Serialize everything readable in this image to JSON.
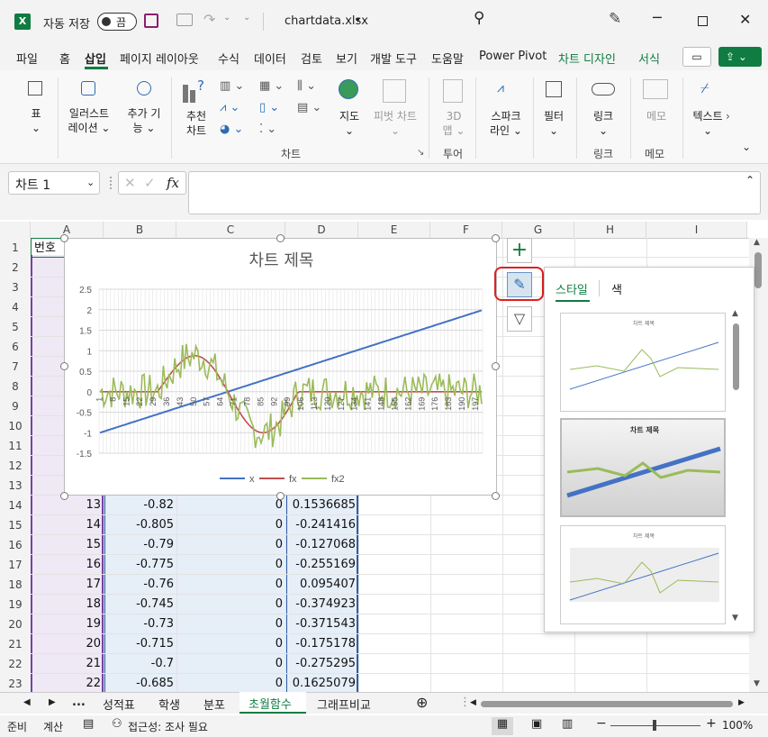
{
  "titlebar": {
    "autosave_label": "자동 저장",
    "autosave_state": "끔",
    "filename": "chartdata.xlsx"
  },
  "tabs": [
    "파일",
    "홈",
    "삽입",
    "페이지 레이아웃",
    "수식",
    "데이터",
    "검토",
    "보기",
    "개발 도구",
    "도움말",
    "Power Pivot",
    "차트 디자인",
    "서식"
  ],
  "active_tab": "삽입",
  "ribbon": {
    "buttons": [
      {
        "name": "table",
        "lines": [
          "표",
          "⌄"
        ]
      },
      {
        "name": "illustrations",
        "lines": [
          "일러스트",
          "레이션 ⌄"
        ]
      },
      {
        "name": "addins",
        "lines": [
          "추가 기",
          "능 ⌄"
        ]
      },
      {
        "name": "recommended-charts",
        "lines": [
          "추천",
          "차트"
        ]
      },
      {
        "name": "maps",
        "lines": [
          "지도",
          "⌄"
        ]
      },
      {
        "name": "pivotchart",
        "lines": [
          "피벗 차트",
          "⌄"
        ]
      },
      {
        "name": "3dmap",
        "lines": [
          "3D",
          "맵 ⌄"
        ]
      },
      {
        "name": "sparklines",
        "lines": [
          "스파크",
          "라인 ⌄"
        ]
      },
      {
        "name": "filters",
        "lines": [
          "필터",
          "⌄"
        ]
      },
      {
        "name": "link",
        "lines": [
          "링크",
          "⌄"
        ]
      },
      {
        "name": "comment",
        "lines": [
          "메모",
          ""
        ]
      },
      {
        "name": "text",
        "lines": [
          "텍스트",
          "⌄"
        ]
      }
    ],
    "groups": [
      "차트",
      "투어",
      "링크",
      "메모"
    ]
  },
  "formula": {
    "namebox": "차트 1",
    "fx": "fx"
  },
  "columns": [
    "A",
    "B",
    "C",
    "D",
    "E",
    "F",
    "G",
    "H",
    "I"
  ],
  "rows": [
    {
      "n": "1",
      "a": "번호",
      "b": "",
      "c": "",
      "d": ""
    },
    {
      "n": "2",
      "a": "",
      "b": "",
      "c": "",
      "d": ""
    },
    {
      "n": "3",
      "a": "",
      "b": "",
      "c": "",
      "d": ""
    },
    {
      "n": "4",
      "a": "",
      "b": "",
      "c": "",
      "d": ""
    },
    {
      "n": "5",
      "a": "",
      "b": "",
      "c": "",
      "d": ""
    },
    {
      "n": "6",
      "a": "",
      "b": "",
      "c": "",
      "d": ""
    },
    {
      "n": "7",
      "a": "",
      "b": "",
      "c": "",
      "d": ""
    },
    {
      "n": "8",
      "a": "",
      "b": "",
      "c": "",
      "d": ""
    },
    {
      "n": "9",
      "a": "",
      "b": "",
      "c": "",
      "d": ""
    },
    {
      "n": "10",
      "a": "",
      "b": "",
      "c": "",
      "d": ""
    },
    {
      "n": "11",
      "a": "",
      "b": "",
      "c": "",
      "d": ""
    },
    {
      "n": "12",
      "a": "",
      "b": "",
      "c": "",
      "d": ""
    },
    {
      "n": "13",
      "a": "",
      "b": "",
      "c": "",
      "d": ""
    },
    {
      "n": "14",
      "a": "13",
      "b": "-0.82",
      "c": "0",
      "d": "0.1536685"
    },
    {
      "n": "15",
      "a": "14",
      "b": "-0.805",
      "c": "0",
      "d": "-0.241416"
    },
    {
      "n": "16",
      "a": "15",
      "b": "-0.79",
      "c": "0",
      "d": "-0.127068"
    },
    {
      "n": "17",
      "a": "16",
      "b": "-0.775",
      "c": "0",
      "d": "-0.255169"
    },
    {
      "n": "18",
      "a": "17",
      "b": "-0.76",
      "c": "0",
      "d": "0.095407"
    },
    {
      "n": "19",
      "a": "18",
      "b": "-0.745",
      "c": "0",
      "d": "-0.374923"
    },
    {
      "n": "20",
      "a": "19",
      "b": "-0.73",
      "c": "0",
      "d": "-0.371543"
    },
    {
      "n": "21",
      "a": "20",
      "b": "-0.715",
      "c": "0",
      "d": "-0.175178"
    },
    {
      "n": "22",
      "a": "21",
      "b": "-0.7",
      "c": "0",
      "d": "-0.275295"
    },
    {
      "n": "23",
      "a": "22",
      "b": "-0.685",
      "c": "0",
      "d": "0.1625079"
    }
  ],
  "chart": {
    "title": "차트 제목",
    "yticks": [
      "2.5",
      "2",
      "1.5",
      "1",
      "0.5",
      "0",
      "-0.5",
      "-1",
      "-1.5"
    ],
    "xticks": [
      "1",
      "8",
      "15",
      "22",
      "29",
      "36",
      "43",
      "50",
      "57",
      "64",
      "71",
      "78",
      "85",
      "92",
      "99",
      "106",
      "113",
      "120",
      "127",
      "134",
      "141",
      "148",
      "155",
      "162",
      "169",
      "176",
      "183",
      "190",
      "197"
    ],
    "legend": [
      "x",
      "fx",
      "fx2"
    ],
    "colors": {
      "x": "#4472c4",
      "fx": "#c0504d",
      "fx2": "#9bbb59"
    }
  },
  "style_panel": {
    "tabs": [
      "스타일",
      "색"
    ],
    "thumb_title": "차트 제목"
  },
  "sheets": [
    "...",
    "성적표",
    "학생",
    "분포",
    "초월함수",
    "그래프비교"
  ],
  "active_sheet": "초월함수",
  "status": {
    "ready": "준비",
    "calc": "계산",
    "accessibility": "접근성: 조사 필요",
    "zoom": "100%"
  }
}
